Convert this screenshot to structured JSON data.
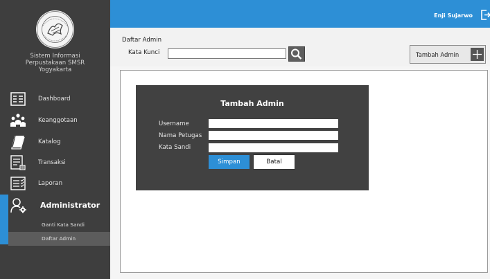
{
  "sidebar": {
    "app_title_lines": [
      "Sistem Informasi",
      "Perpustakaan SMSR",
      "Yogyakarta"
    ],
    "items": [
      {
        "label": "Dashboard",
        "icon": "dashboard-icon"
      },
      {
        "label": "Keanggotaan",
        "icon": "members-icon"
      },
      {
        "label": "Katalog",
        "icon": "book-icon"
      },
      {
        "label": "Transaksi",
        "icon": "transaction-icon"
      },
      {
        "label": "Laporan",
        "icon": "report-icon"
      }
    ],
    "admin": {
      "label": "Administrator",
      "icon": "user-gear-icon",
      "subitems": [
        {
          "label": "Ganti Kata Sandi"
        },
        {
          "label": "Daftar Admin"
        }
      ]
    }
  },
  "topbar": {
    "username": "Enji Sujarwo"
  },
  "filter": {
    "section_title": "Daftar Admin",
    "keyword_label": "Kata Kunci",
    "keyword_value": "",
    "add_button_label": "Tambah Admin"
  },
  "modal": {
    "title": "Tambah Admin",
    "fields": [
      {
        "label": "Username",
        "value": ""
      },
      {
        "label": "Nama Petugas",
        "value": ""
      },
      {
        "label": "Kata Sandi",
        "value": ""
      }
    ],
    "save_label": "Simpan",
    "cancel_label": "Batal"
  },
  "colors": {
    "accent": "#2d8fd6",
    "sidebar_bg": "#3e3e3e",
    "modal_bg": "#414141"
  }
}
